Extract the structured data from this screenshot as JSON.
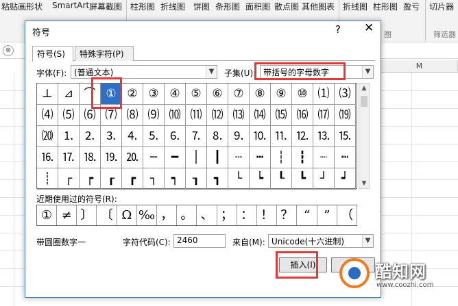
{
  "ribbon": {
    "items": [
      "粘贴画",
      "形状",
      "SmartArt",
      "屏幕截图",
      "柱形图",
      "折线图",
      "饼图",
      "条形图",
      "面积图",
      "散点图",
      "其他图表",
      "折线图",
      "柱形图",
      "盈亏",
      "切片器"
    ],
    "groups": [
      "图",
      "筛选器"
    ]
  },
  "sheet": {
    "name_box_icon": "⊗",
    "col_m": "M"
  },
  "dialog": {
    "title": "符号",
    "help": "?",
    "close": "✕",
    "tabs": [
      "符号(S)",
      "特殊字符(P)"
    ],
    "font_label": "字体(F):",
    "font_value": "(普通文本)",
    "subset_label": "子集(U):",
    "subset_value": "带括号的字母数字",
    "symbols": [
      "⊥",
      "⊿",
      "⌒",
      "①",
      "②",
      "③",
      "④",
      "⑤",
      "⑥",
      "⑦",
      "⑧",
      "⑨",
      "⑩",
      "⑴",
      "⑶",
      "⑷",
      "⑸",
      "⑹",
      "⑺",
      "⑻",
      "⑼",
      "⑽",
      "⑾",
      "⑿",
      "⒀",
      "⒁",
      "⒂",
      "⒃",
      "⒄",
      "⒆",
      "⒇",
      "⒈",
      "⒉",
      "⒊",
      "⒋",
      "⒌",
      "⒍",
      "⒎",
      "⒏",
      "⒐",
      "⒑",
      "⒒",
      "⒓",
      "⒔",
      "⒖",
      "⒗",
      "⒘",
      "⒙",
      "⒚",
      "⒛",
      "─",
      "━",
      "│",
      "┃",
      "┄",
      "┅",
      "┆",
      "┇",
      "┈",
      "┉",
      "┊",
      "┌",
      "┍",
      "┎",
      "┏",
      "┐",
      "┑",
      "┒",
      "┓",
      "└",
      "┕",
      "┖",
      "┗",
      "┘",
      "┙"
    ],
    "recent_label": "近期使用过的符号(R):",
    "recent": [
      "①",
      "≠",
      "〕",
      "〔",
      "Ω",
      "‰",
      "，",
      "。",
      "、",
      "；",
      "：",
      "！",
      "？",
      "“",
      "”",
      "（"
    ],
    "char_name": "带圆圈数字一",
    "code_label": "字符代码(C):",
    "code_value": "2460",
    "from_label": "来自(M):",
    "from_value": "Unicode(十六进制)",
    "insert_label": "插入(I)",
    "cancel_label": "取消"
  },
  "watermark": {
    "name": "酷知网",
    "url": "www.coozhi.com"
  },
  "colors": {
    "accent": "#2f6fc6",
    "highlight": "#e03a3a",
    "watermark_orange": "#f07b22"
  }
}
